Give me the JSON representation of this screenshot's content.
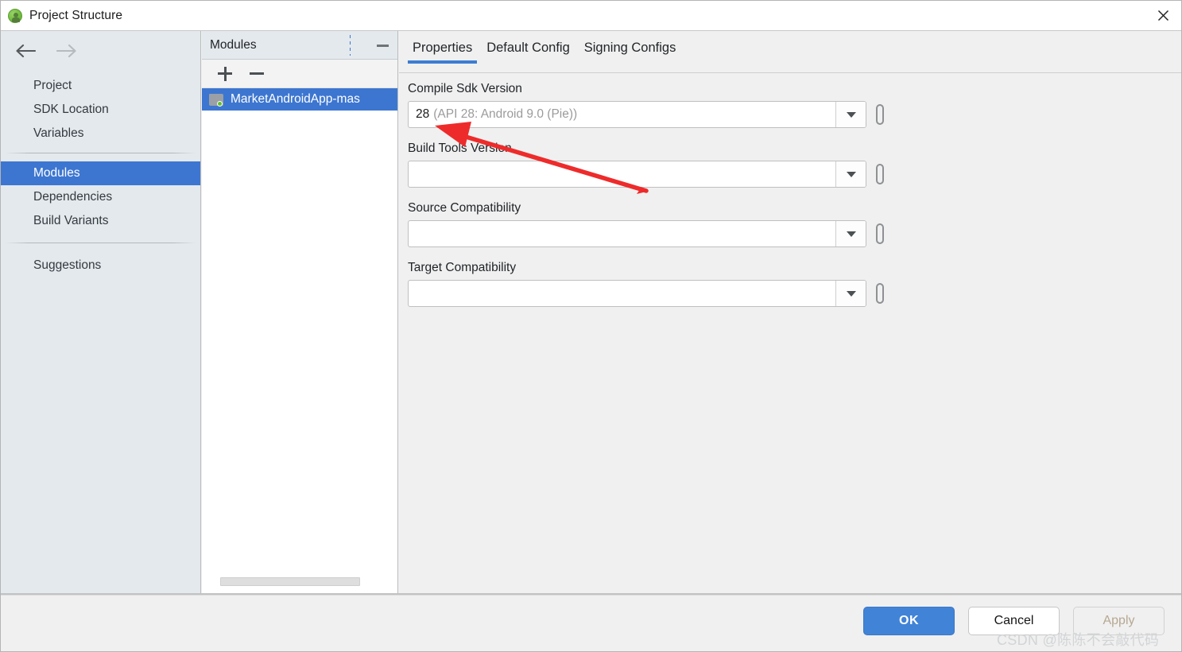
{
  "window": {
    "title": "Project Structure",
    "icon": "android-studio-icon",
    "close_label": "×"
  },
  "sidebar": {
    "nav": {
      "back": "back-arrow",
      "forward": "forward-arrow"
    },
    "items": [
      {
        "label": "Project",
        "selected": false
      },
      {
        "label": "SDK Location",
        "selected": false
      },
      {
        "label": "Variables",
        "selected": false
      },
      {
        "label": "Modules",
        "selected": true
      },
      {
        "label": "Dependencies",
        "selected": false
      },
      {
        "label": "Build Variants",
        "selected": false
      },
      {
        "label": "Suggestions",
        "selected": false
      }
    ]
  },
  "modules_panel": {
    "title": "Modules",
    "minimize_label": "minimize-icon",
    "toolbar": {
      "add_label": "add-module-button",
      "remove_label": "remove-module-button"
    },
    "items": [
      {
        "label": "MarketAndroidApp-mas",
        "selected": true,
        "icon": "module-folder-icon"
      }
    ]
  },
  "main": {
    "tabs": [
      {
        "label": "Properties",
        "active": true
      },
      {
        "label": "Default Config",
        "active": false
      },
      {
        "label": "Signing Configs",
        "active": false
      }
    ],
    "fields": [
      {
        "label": "Compile Sdk Version",
        "value_primary": "28",
        "value_secondary": "(API 28: Android 9.0 (Pie))",
        "placeholder": ""
      },
      {
        "label": "Build Tools Version",
        "value_primary": "",
        "value_secondary": "",
        "placeholder": ""
      },
      {
        "label": "Source Compatibility",
        "value_primary": "",
        "value_secondary": "",
        "placeholder": ""
      },
      {
        "label": "Target Compatibility",
        "value_primary": "",
        "value_secondary": "",
        "placeholder": ""
      }
    ]
  },
  "footer": {
    "ok_label": "OK",
    "cancel_label": "Cancel",
    "apply_label": "Apply",
    "apply_enabled": false
  },
  "watermark": {
    "text": "CSDN @陈陈不会敲代码"
  },
  "annotation": {
    "color": "#ee2b2b",
    "description": "red-arrow-pointing-to-compile-sdk-version"
  },
  "colors": {
    "accent_blue": "#3d76d0",
    "tab_underline": "#3d7dd2",
    "sidebar_bg": "#e4e9ed",
    "annotation_red": "#ee2b2b"
  }
}
